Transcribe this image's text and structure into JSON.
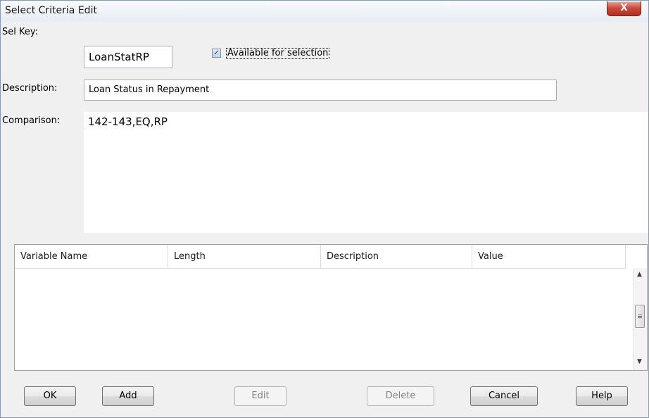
{
  "window": {
    "title": "Select Criteria Edit",
    "close_glyph": "X"
  },
  "form": {
    "sel_key_label": "Sel Key:",
    "sel_key_value": "LoanStatRP",
    "available_label": "Available for selection",
    "available_checked": true,
    "description_label": "Description:",
    "description_value": "Loan Status in Repayment",
    "comparison_label": "Comparison:",
    "comparison_value": "142-143,EQ,RP"
  },
  "grid": {
    "columns": [
      "Variable Name",
      "Length",
      "Description",
      "Value"
    ],
    "rows": []
  },
  "buttons": {
    "ok": "OK",
    "add": "Add",
    "edit": "Edit",
    "delete": "Delete",
    "cancel": "Cancel",
    "help": "Help"
  }
}
